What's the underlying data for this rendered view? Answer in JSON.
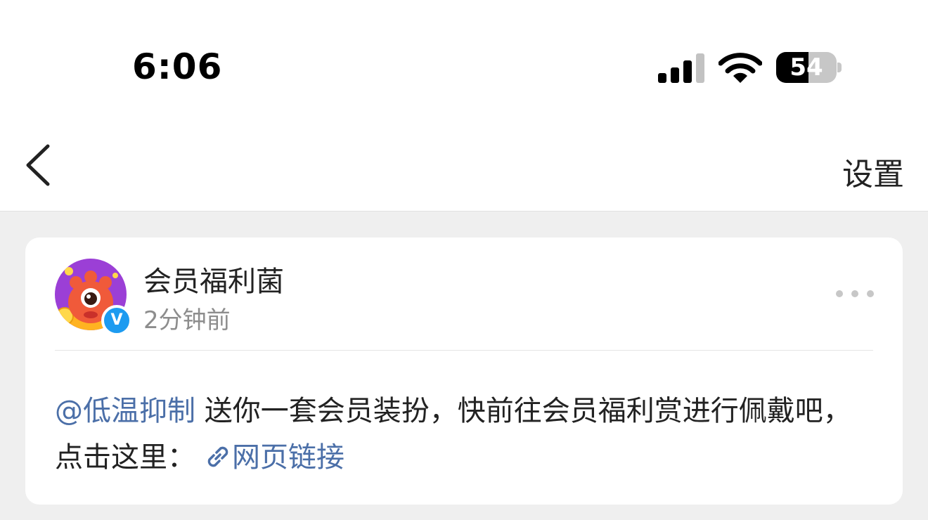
{
  "status_bar": {
    "time": "6:06",
    "battery": "54",
    "battery_level": 0.54
  },
  "nav": {
    "back_icon": "chevron-left-icon",
    "settings_label": "设置"
  },
  "post": {
    "author": "会员福利菌",
    "time_ago": "2分钟前",
    "verified_icon": "verified-badge-icon",
    "verified_mark": "V",
    "more_icon": "more-dots-icon",
    "mention": "@低温抑制",
    "text": " 送你一套会员装扮，快前往会员福利赏进行佩戴吧，点击这里：",
    "link_icon": "link-icon",
    "link_label": "网页链接"
  },
  "colors": {
    "link": "#4b6fa8",
    "verified": "#1d9bf0",
    "avatar_bg": "#9b3fd6",
    "mascot": "#f05a3a"
  }
}
